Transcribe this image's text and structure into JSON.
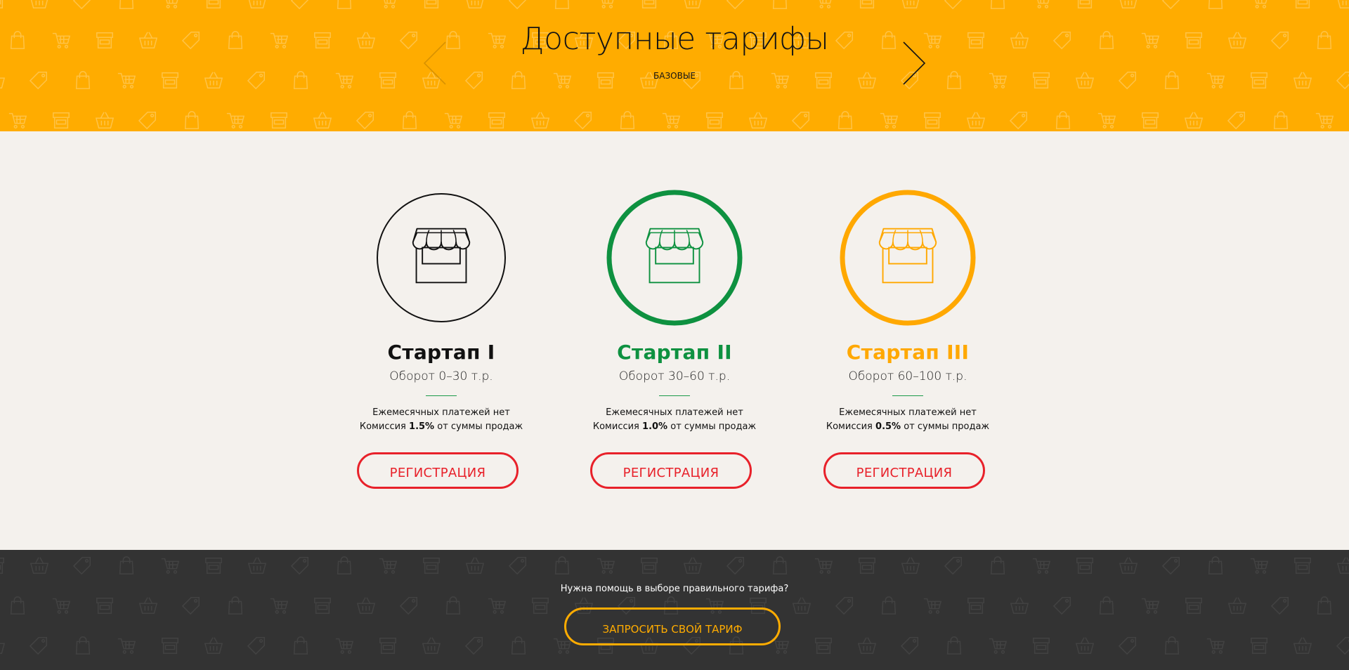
{
  "header": {
    "title": "Доступные тарифы",
    "subtitle": "БАЗОВЫЕ",
    "prev_icon": "chevron-left-icon",
    "next_icon": "chevron-right-icon",
    "background_color": "#ffac00"
  },
  "plans": [
    {
      "name": "Стартап I",
      "turnover": "Оборот 0–30 т.р.",
      "monthly": "Ежемесячных платежей нет",
      "commission_prefix": "Комиссия",
      "commission_value": "1.5%",
      "commission_suffix": "от суммы продаж",
      "button_label": "РЕГИСТРАЦИЯ",
      "accent_color": "#111111",
      "icon": "store-icon"
    },
    {
      "name": "Стартап II",
      "turnover": "Оборот 30–60 т.р.",
      "monthly": "Ежемесячных платежей нет",
      "commission_prefix": "Комиссия",
      "commission_value": "1.0%",
      "commission_suffix": "от суммы продаж",
      "button_label": "РЕГИСТРАЦИЯ",
      "accent_color": "#0e9140",
      "icon": "store-icon"
    },
    {
      "name": "Стартап III",
      "turnover": "Оборот 60–100 т.р.",
      "monthly": "Ежемесячных платежей нет",
      "commission_prefix": "Комиссия",
      "commission_value": "0.5%",
      "commission_suffix": "от суммы продаж",
      "button_label": "РЕГИСТРАЦИЯ",
      "accent_color": "#ffa800",
      "icon": "store-icon"
    }
  ],
  "footer": {
    "help_text": "Нужна помощь в выборе правильного тарифа?",
    "request_button": "ЗАПРОСИТЬ СВОЙ ТАРИФ",
    "background_color": "#333333",
    "accent_color": "#ffac00"
  }
}
